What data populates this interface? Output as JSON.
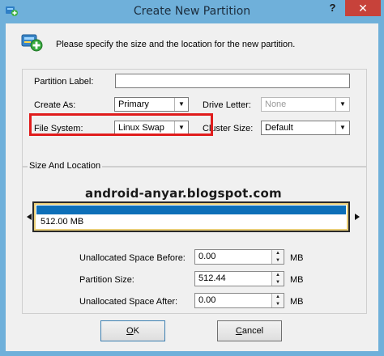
{
  "window": {
    "title": "Create New Partition",
    "help_label": "?",
    "close_label": "✕"
  },
  "header": {
    "instruction": "Please specify the size and the location for the new partition."
  },
  "fields": {
    "partition_label": {
      "label": "Partition Label:",
      "value": ""
    },
    "create_as": {
      "label": "Create As:",
      "value": "Primary"
    },
    "drive_letter": {
      "label": "Drive Letter:",
      "value": "None"
    },
    "file_system": {
      "label": "File System:",
      "value": "Linux Swap"
    },
    "cluster_size": {
      "label": "Cluster Size:",
      "value": "Default"
    }
  },
  "size_location": {
    "title": "Size And Location",
    "bar_size_text": "512.00 MB",
    "watermark": "android-anyar.blogspot.com",
    "unalloc_before": {
      "label": "Unallocated Space Before:",
      "value": "0.00",
      "unit": "MB"
    },
    "partition_size": {
      "label": "Partition Size:",
      "value": "512.44",
      "unit": "MB"
    },
    "unalloc_after": {
      "label": "Unallocated Space After:",
      "value": "0.00",
      "unit": "MB"
    }
  },
  "buttons": {
    "ok": {
      "label_underlined": "O",
      "label_rest": "K"
    },
    "cancel": {
      "label_underlined": "C",
      "label_rest": "ancel"
    }
  },
  "colors": {
    "title_bar": "#6fb0da",
    "close_button": "#c7423a",
    "highlight_box": "#e01c1c",
    "partition_fill": "#0d6fb8"
  }
}
